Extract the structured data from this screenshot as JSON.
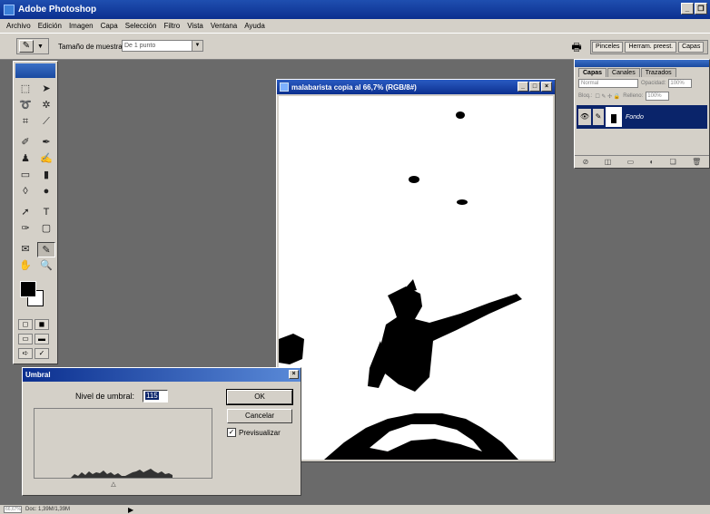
{
  "app": {
    "title": "Adobe Photoshop"
  },
  "menu": [
    "Archivo",
    "Edición",
    "Imagen",
    "Capa",
    "Selección",
    "Filtro",
    "Vista",
    "Ventana",
    "Ayuda"
  ],
  "options": {
    "sample_size_label": "Tamaño de muestra:",
    "sample_size_value": "De 1 punto",
    "palette_well": [
      "Pinceles",
      "Herram. preest.",
      "Capas"
    ]
  },
  "document": {
    "title": "malabarista copia al 66,7% (RGB/8#)"
  },
  "layers_panel": {
    "tabs": [
      "Capas",
      "Canales",
      "Trazados"
    ],
    "blend_mode": "Normal",
    "opacity_label": "Opacidad:",
    "opacity_value": "100%",
    "lock_label": "Bloq.:",
    "fill_label": "Relleno:",
    "fill_value": "100%",
    "layer_name": "Fondo"
  },
  "threshold_dialog": {
    "title": "Umbral",
    "level_label": "Nivel de umbral:",
    "level_value": "115",
    "ok_label": "OK",
    "cancel_label": "Cancelar",
    "preview_label": "Previsualizar",
    "preview_checked": true
  },
  "status": {
    "zoom": "66,67%",
    "doc_info": "Doc: 1,39M/1,39M"
  },
  "colors": {
    "title_blue": "#0b2f8f",
    "chrome": "#d4d0c8",
    "workspace": "#6a6a6a",
    "selection": "#0a246a"
  }
}
